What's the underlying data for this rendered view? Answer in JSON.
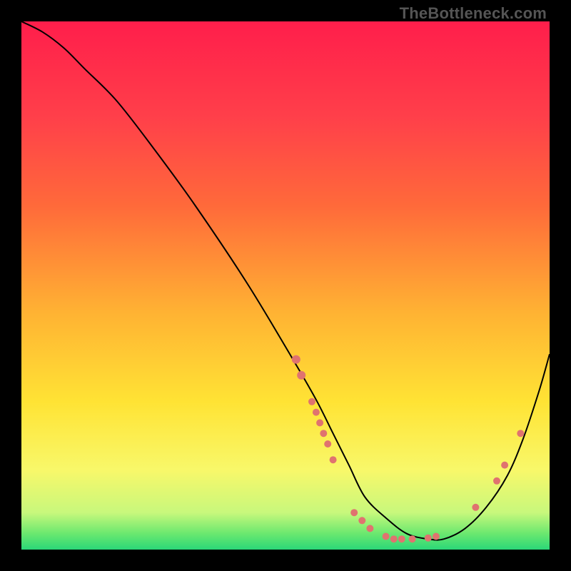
{
  "watermark": "TheBottleneck.com",
  "chart_data": {
    "type": "line",
    "title": "",
    "xlabel": "",
    "ylabel": "",
    "xlim": [
      0,
      100
    ],
    "ylim": [
      0,
      100
    ],
    "gradient_stops": [
      {
        "offset": 0,
        "color": "#ff1e4b"
      },
      {
        "offset": 18,
        "color": "#ff3f4a"
      },
      {
        "offset": 35,
        "color": "#ff6a3a"
      },
      {
        "offset": 55,
        "color": "#ffb233"
      },
      {
        "offset": 72,
        "color": "#ffe334"
      },
      {
        "offset": 85,
        "color": "#f8f86a"
      },
      {
        "offset": 93,
        "color": "#c8f87c"
      },
      {
        "offset": 97,
        "color": "#6ae86f"
      },
      {
        "offset": 100,
        "color": "#2bd778"
      }
    ],
    "series": [
      {
        "name": "bottleneck-curve",
        "x": [
          0,
          4,
          8,
          12,
          18,
          25,
          33,
          43,
          52,
          56,
          59,
          62,
          65,
          69,
          73,
          77,
          80,
          84,
          88,
          92,
          95,
          98,
          100
        ],
        "y": [
          100,
          98,
          95,
          91,
          85,
          76,
          65,
          50,
          35,
          28,
          22,
          16,
          10,
          6,
          3,
          2,
          2,
          4,
          8,
          14,
          21,
          30,
          37
        ]
      }
    ],
    "points": [
      {
        "x": 52,
        "y": 36,
        "r": 6
      },
      {
        "x": 53,
        "y": 33,
        "r": 6
      },
      {
        "x": 55,
        "y": 28,
        "r": 5
      },
      {
        "x": 55.8,
        "y": 26,
        "r": 5
      },
      {
        "x": 56.5,
        "y": 24,
        "r": 5
      },
      {
        "x": 57.2,
        "y": 22,
        "r": 5
      },
      {
        "x": 58,
        "y": 20,
        "r": 5
      },
      {
        "x": 59,
        "y": 17,
        "r": 5
      },
      {
        "x": 63,
        "y": 7,
        "r": 5
      },
      {
        "x": 64.5,
        "y": 5.5,
        "r": 5
      },
      {
        "x": 66,
        "y": 4,
        "r": 5
      },
      {
        "x": 69,
        "y": 2.5,
        "r": 5
      },
      {
        "x": 70.5,
        "y": 2,
        "r": 5
      },
      {
        "x": 72,
        "y": 2,
        "r": 5
      },
      {
        "x": 74,
        "y": 2,
        "r": 5
      },
      {
        "x": 77,
        "y": 2.2,
        "r": 5
      },
      {
        "x": 78.5,
        "y": 2.5,
        "r": 5
      },
      {
        "x": 86,
        "y": 8,
        "r": 5
      },
      {
        "x": 90,
        "y": 13,
        "r": 5
      },
      {
        "x": 91.5,
        "y": 16,
        "r": 5
      },
      {
        "x": 94.5,
        "y": 22,
        "r": 5
      }
    ],
    "point_color": "#e0736f",
    "curve_color": "#000000"
  }
}
